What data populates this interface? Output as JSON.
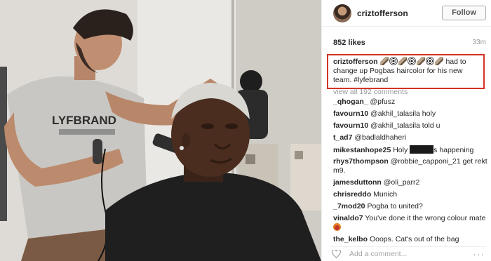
{
  "post": {
    "username": "criztofferson",
    "follow_label": "Follow",
    "likes": "852 likes",
    "time": "33m"
  },
  "caption": {
    "username": "criztofferson",
    "emojis": [
      "clipper-icon",
      "soccer-ball-icon",
      "clipper-icon",
      "soccer-ball-icon",
      "clipper-icon",
      "soccer-ball-icon",
      "clipper-icon"
    ],
    "text": "had to change up Pogbas haircolor for his new team. #lyfebrand",
    "border_color": "#d33325"
  },
  "view_all": "view all 192 comments",
  "comments": [
    {
      "user": "_qhogan_",
      "text": "@pfusz"
    },
    {
      "user": "favourn10",
      "text": "@akhil_talasila holy"
    },
    {
      "user": "favourn10",
      "text": "@akhil_talasila told u"
    },
    {
      "user": "t_ad7",
      "text": "@badlaldhaheri"
    },
    {
      "user": "mikestanhope25",
      "text_before": "Holy",
      "text_after": "s happening"
    },
    {
      "user": "rhys7thompson",
      "text": "@robbie_capponi_21 get rekt m9."
    },
    {
      "user": "jamesduttonn",
      "text": "@oli_parr2"
    },
    {
      "user": "chrisreddo",
      "text": "Munich"
    },
    {
      "user": "_7mod20",
      "text": "Pogba to united?"
    },
    {
      "user": "vinaldo7",
      "text": "You've done it the wrong colour mate"
    },
    {
      "user": "the_kelbo",
      "text": "Ooops. Cat's out of the bag"
    }
  ],
  "add_comment_placeholder": "Add a comment...",
  "shirt_text": "LYFBRAND"
}
